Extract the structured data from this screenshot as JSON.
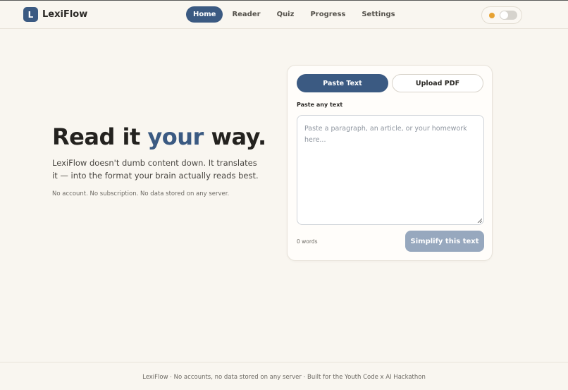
{
  "brand": {
    "logo_letter": "L",
    "name": "LexiFlow"
  },
  "nav": {
    "items": [
      {
        "label": "Home",
        "active": true
      },
      {
        "label": "Reader"
      },
      {
        "label": "Quiz"
      },
      {
        "label": "Progress"
      },
      {
        "label": "Settings"
      }
    ]
  },
  "theme_toggle": {
    "icon": "sun-icon",
    "state": "off"
  },
  "hero": {
    "title_pre": "Read it ",
    "title_accent": "your",
    "title_post": " way.",
    "subtitle": "LexiFlow doesn't dumb content down. It translates it — into the format your brain actually reads best.",
    "note": "No account. No subscription. No data stored on any server."
  },
  "input_card": {
    "tabs": [
      {
        "label": "Paste Text",
        "active": true
      },
      {
        "label": "Upload PDF"
      }
    ],
    "field_label": "Paste any text",
    "placeholder": "Paste a paragraph, an article, or your homework here...",
    "word_count": "0 words",
    "submit_label": "Simplify this text"
  },
  "footer": {
    "text": "LexiFlow · No accounts, no data stored on any server · Built for the Youth Code x AI Hackathon"
  },
  "colors": {
    "accent": "#3b5a82",
    "background": "#f9f6f0",
    "button_disabled": "#97a8be",
    "sun": "#e7a233"
  }
}
